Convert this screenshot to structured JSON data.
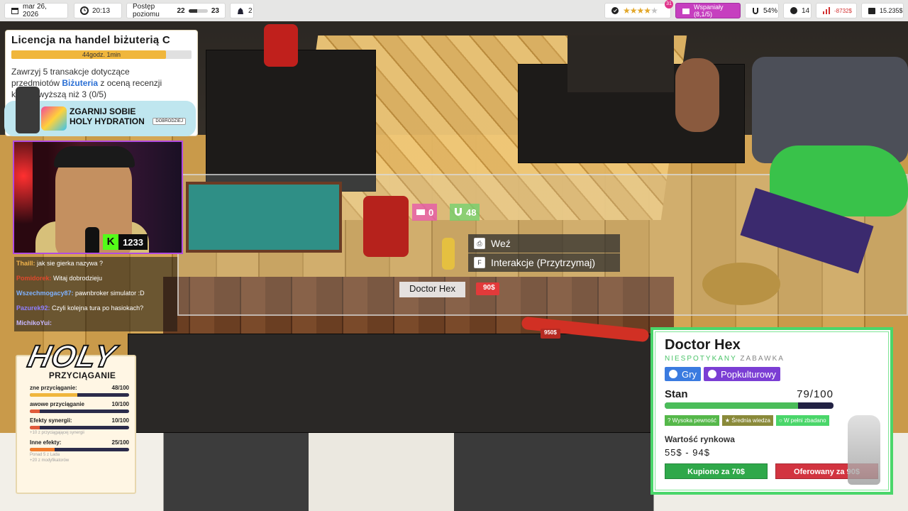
{
  "colors": {
    "accent_green": "#4ad66a",
    "accent_pink": "#c63fbf",
    "price_red": "#e23a3a",
    "bought_button": "#2fa84a",
    "offered_button": "#d23440",
    "category_blue": "#3a7be0",
    "category_purple": "#7b3ed4"
  },
  "topbar": {
    "date": "mar 26, 2026",
    "time": "20:13",
    "level_label": "Postęp poziomu",
    "level_from": "22",
    "level_to": "23",
    "level_progress": 0.45,
    "pawn_count": "2",
    "rating_badge": "31",
    "rating_stars": 4,
    "rating_label": "Wspaniały (8,1/5)",
    "magnet_pct": "54%",
    "customers": "14",
    "chart_value": "-8732$",
    "money": "15.235$",
    "icons": [
      "calendar-icon",
      "clock-icon",
      "pawn-icon",
      "medal-icon",
      "magnet-icon",
      "person-icon",
      "chart-icon",
      "wallet-icon"
    ]
  },
  "quest": {
    "title": "Licencja na handel biżuterią C",
    "timer": "44godz. 1min",
    "timer_progress": 0.86,
    "desc_pre": "Zawrzyj 5 transakcje dotyczące",
    "desc_mid_pre": "przedmiotów",
    "desc_highlight": "Biżuteria",
    "desc_mid_post": "z oceną recenzji",
    "desc_tail": "klienta wyższą niż 3 (0/5)"
  },
  "sponsor": {
    "headline_1": "ZGARNIJ SOBIE",
    "headline_2": "HOLY HYDRATION",
    "tag": "DOBRODZIEJ"
  },
  "webcam": {
    "kick_letter": "K",
    "viewers": "1233"
  },
  "chat": [
    {
      "user": "Thaill:",
      "text": "jak sie gierka nazywa ?",
      "user_color": "#f2b44c"
    },
    {
      "user": "Pomidorek:",
      "text": "Witaj dobrodzieju",
      "user_color": "#e0482c"
    },
    {
      "user": "Wszechmogacy87:",
      "text": "pawnbroker simulator :D",
      "user_color": "#7fb2ff"
    },
    {
      "user": "Pazurek92:",
      "text": "Czyli kolejna tura po hasiokach?",
      "user_color": "#8f7fff"
    },
    {
      "user": "MichikoYui:",
      "text": "",
      "user_color": "#c8b8ff"
    }
  ],
  "attraction": {
    "logo": "HOLY",
    "header": "PRZYCIĄGANIE",
    "rows": [
      {
        "label": "zne przyciąganie:",
        "value": "48/100",
        "fill": 0.48,
        "color": "#f0b63c",
        "sub": ""
      },
      {
        "label": "awowe przyciąganie",
        "value": "10/100",
        "fill": 0.1,
        "color": "#e05a3a",
        "sub": ""
      },
      {
        "label": "Efekty synergii:",
        "value": "10/100",
        "fill": 0.1,
        "color": "#e05a3a",
        "sub": "+10 z przyciągającej synergii"
      },
      {
        "label": "Inne efekty:",
        "value": "25/100",
        "fill": 0.25,
        "color": "#f07a2a",
        "sub": "Ponad 5 z Lada"
      },
      {
        "label": "",
        "value": "",
        "fill": 0,
        "color": "#f07a2a",
        "sub": "+20 z modyfikatorów"
      }
    ]
  },
  "world": {
    "pink_value": "0",
    "green_value": "48",
    "prompt_take_key": "⎙",
    "prompt_take": "Weź",
    "prompt_interact_key": "F",
    "prompt_interact": "Interakcje (Przytrzymaj)",
    "item_name": "Doctor Hex",
    "item_price": "90$",
    "bat_price": "950$"
  },
  "detail": {
    "name": "Doctor Hex",
    "rarity": "NIESPOTYKANY",
    "category_word": "ZABAWKA",
    "tags": [
      "Gry",
      "Popkulturowy"
    ],
    "condition_label": "Stan",
    "condition_value": "79/100",
    "condition_fill": 0.79,
    "knowledge": [
      "? Wysoka pewność",
      "★ Średnia wiedza",
      "○ W pełni zbadano"
    ],
    "market_label": "Wartość rynkowa",
    "market_value": "55$ - 94$",
    "bought_label": "Kupiono za 70$",
    "offered_label": "Oferowany za 90$"
  }
}
